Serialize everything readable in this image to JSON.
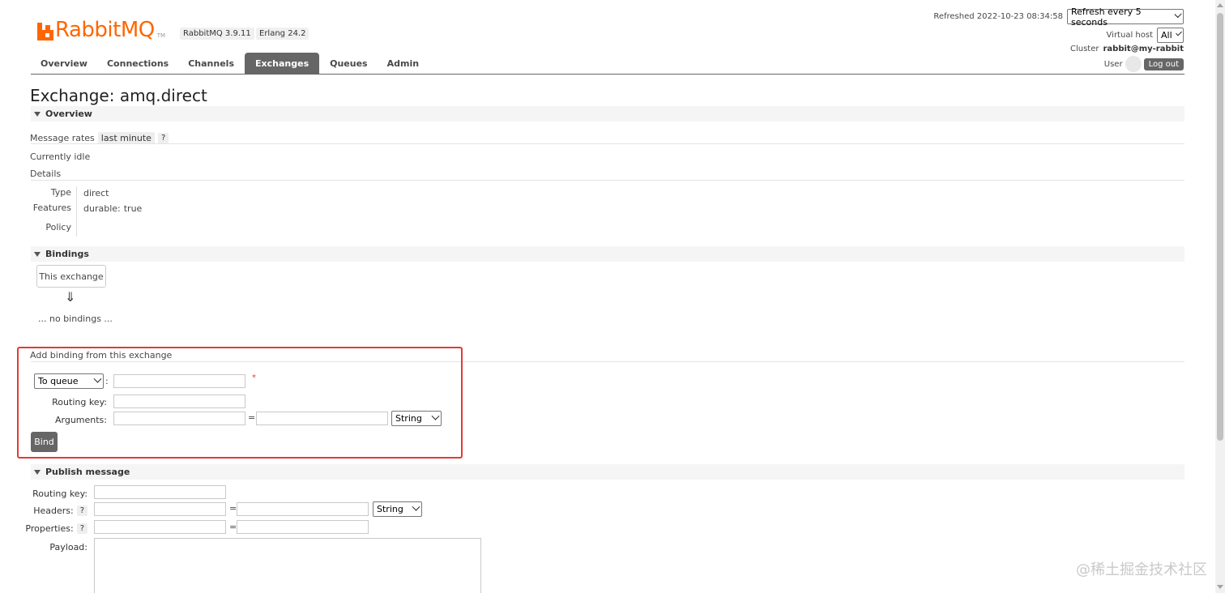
{
  "logo": {
    "text_rabbit": "Rabbit",
    "text_mq": "MQ",
    "tm": "TM"
  },
  "versions": {
    "rabbitmq": "RabbitMQ 3.9.11",
    "erlang": "Erlang 24.2"
  },
  "header": {
    "refreshed_label": "Refreshed 2022-10-23 08:34:58",
    "refresh_select": "Refresh every 5 seconds",
    "vhost_label": "Virtual host",
    "vhost_select": "All",
    "cluster_label": "Cluster",
    "cluster_name": "rabbit@my-rabbit",
    "user_label": "User",
    "logout": "Log out"
  },
  "nav": {
    "tabs": [
      "Overview",
      "Connections",
      "Channels",
      "Exchanges",
      "Queues",
      "Admin"
    ],
    "active": "Exchanges"
  },
  "page_title": "Exchange: amq.direct",
  "overview": {
    "section_title": "Overview",
    "message_rates_label": "Message rates",
    "message_rates_value": "last minute",
    "help": "?",
    "idle_text": "Currently idle",
    "details_label": "Details",
    "type_label": "Type",
    "type_value": "direct",
    "features_label": "Features",
    "durable_key": "durable:",
    "durable_value": "true",
    "policy_label": "Policy"
  },
  "bindings": {
    "section_title": "Bindings",
    "this_exchange": "This exchange",
    "arrow": "⇓",
    "no_bindings": "... no bindings ..."
  },
  "add_binding": {
    "title": "Add binding from this exchange",
    "destination_select": "To queue",
    "colon": ":",
    "required_mark": "*",
    "routing_key_label": "Routing key:",
    "arguments_label": "Arguments:",
    "equals": "=",
    "type_select": "String",
    "bind_button": "Bind"
  },
  "publish": {
    "section_title": "Publish message",
    "routing_key_label": "Routing key:",
    "headers_label": "Headers:",
    "properties_label": "Properties:",
    "payload_label": "Payload:",
    "help": "?",
    "equals": "=",
    "type_select": "String"
  },
  "watermark": "@稀土掘金技术社区",
  "colors": {
    "brand": "#ff6600",
    "tab_active": "#666666",
    "highlight": "#e53935"
  }
}
